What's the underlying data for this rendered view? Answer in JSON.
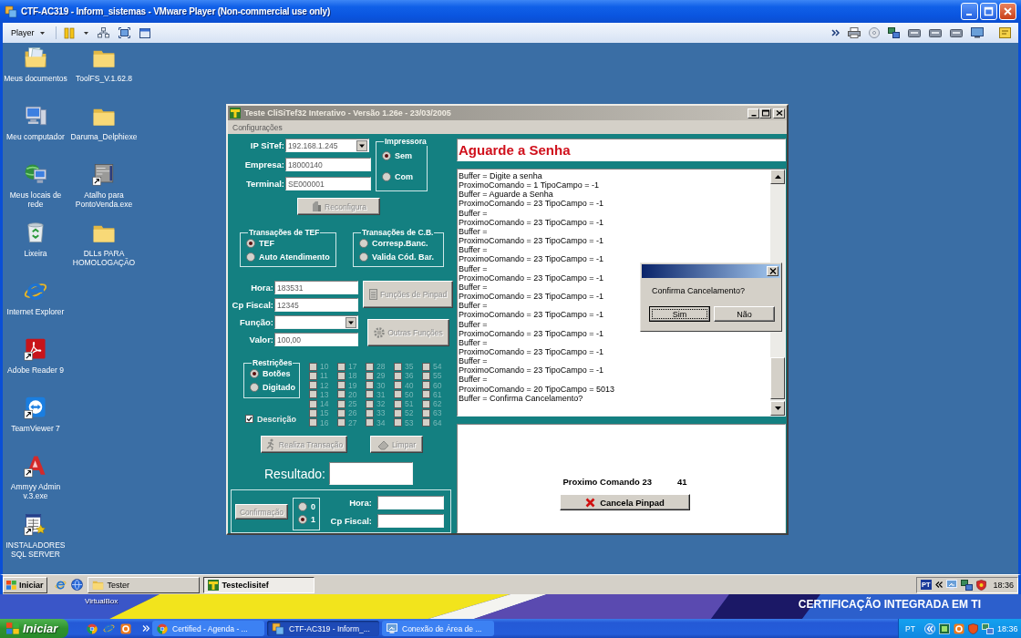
{
  "vm_window": {
    "title": "CTF-AC319 - Inform_sistemas - VMware Player (Non-commercial use only)",
    "player_menu": "Player"
  },
  "desktop_icons": [
    {
      "label": "Meus documentos",
      "kind": "documents",
      "shortcut": false
    },
    {
      "label": "Meu computador",
      "kind": "computer",
      "shortcut": false
    },
    {
      "label": "Meus locais de rede",
      "kind": "network",
      "shortcut": false
    },
    {
      "label": "Lixeira",
      "kind": "bin",
      "shortcut": false
    },
    {
      "label": "Internet Explorer",
      "kind": "browser",
      "shortcut": false
    },
    {
      "label": "Adobe Reader 9",
      "kind": "pdf",
      "shortcut": true
    },
    {
      "label": "TeamViewer 7",
      "kind": "remote",
      "shortcut": true
    },
    {
      "label": "Ammyy Admin v.3.exe",
      "kind": "admin",
      "shortcut": true
    },
    {
      "label": "INSTALADORES SQL SERVER",
      "kind": "installer",
      "shortcut": true
    },
    {
      "label": "ToolFS_V.1.62.8",
      "kind": "folder",
      "shortcut": false
    },
    {
      "label": "Daruma_Delphiexe",
      "kind": "folder",
      "shortcut": false
    },
    {
      "label": "Atalho para PontoVenda.exe",
      "kind": "program",
      "shortcut": true
    },
    {
      "label": "DLLs PARA HOMOLOGAÇÃO",
      "kind": "folder",
      "shortcut": false
    }
  ],
  "app_window": {
    "title": "Teste CliSiTef32 Interativo - Versão 1.26e - 23/03/2005",
    "menu": [
      "Configurações"
    ],
    "connection_fields": [
      {
        "label": "IP SiTef:",
        "value": "192.168.1.245",
        "kind": "combo"
      },
      {
        "label": "Empresa:",
        "value": "18000140",
        "kind": "text"
      },
      {
        "label": "Terminal:",
        "value": "SE000001",
        "kind": "text"
      }
    ],
    "printer_group": {
      "title": "Impressora",
      "options": [
        {
          "label": "Sem",
          "selected": true
        },
        {
          "label": "Com",
          "selected": false
        }
      ]
    },
    "reconfigure_button": {
      "label": "Reconfigura",
      "disabled": true
    },
    "tef_group": {
      "title": "Transações de TEF",
      "options": [
        {
          "label": "TEF",
          "selected": true
        },
        {
          "label": "Auto Atendimento",
          "selected": false
        }
      ]
    },
    "cb_group": {
      "title": "Transações de C.B.",
      "options": [
        {
          "label": "Corresp.Banc.",
          "selected": false
        },
        {
          "label": "Valida Cód. Bar.",
          "selected": false
        }
      ]
    },
    "transaction_fields": [
      {
        "label": "Hora:",
        "value": "183531",
        "kind": "text"
      },
      {
        "label": "Cp Fiscal:",
        "value": "12345",
        "kind": "text"
      },
      {
        "label": "Função:",
        "kind": "combo"
      },
      {
        "label": "Valor:",
        "value": "100,00",
        "kind": "text"
      }
    ],
    "pinpad_button": {
      "label": "Funções de Pinpad",
      "disabled": true
    },
    "other_functions_button": {
      "label": "Outras Funções",
      "disabled": true
    },
    "restrictions_group": {
      "title": "Restrições",
      "options": [
        {
          "label": "Botões",
          "selected": true
        },
        {
          "label": "Digitado",
          "selected": false
        }
      ]
    },
    "description_checkbox": {
      "label": "Descrição",
      "checked": true
    },
    "code_checkboxes": [
      {
        "label": "10",
        "checked": false,
        "disabled": true
      },
      {
        "label": "11",
        "checked": false,
        "disabled": true
      },
      {
        "label": "12",
        "checked": false,
        "disabled": true
      },
      {
        "label": "13",
        "checked": false,
        "disabled": true
      },
      {
        "label": "14",
        "checked": false,
        "disabled": true
      },
      {
        "label": "15",
        "checked": false,
        "disabled": true
      },
      {
        "label": "16",
        "checked": false,
        "disabled": true
      },
      {
        "label": "17",
        "checked": false,
        "disabled": true
      },
      {
        "label": "18",
        "checked": false,
        "disabled": true
      },
      {
        "label": "19",
        "checked": false,
        "disabled": true
      },
      {
        "label": "20",
        "checked": false,
        "disabled": true
      },
      {
        "label": "25",
        "checked": false,
        "disabled": true
      },
      {
        "label": "26",
        "checked": false,
        "disabled": true
      },
      {
        "label": "27",
        "checked": false,
        "disabled": true
      },
      {
        "label": "28",
        "checked": false,
        "disabled": true
      },
      {
        "label": "29",
        "checked": false,
        "disabled": true
      },
      {
        "label": "30",
        "checked": false,
        "disabled": true
      },
      {
        "label": "31",
        "checked": false,
        "disabled": true
      },
      {
        "label": "32",
        "checked": false,
        "disabled": true
      },
      {
        "label": "33",
        "checked": false,
        "disabled": true
      },
      {
        "label": "34",
        "checked": false,
        "disabled": true
      },
      {
        "label": "35",
        "checked": false,
        "disabled": true
      },
      {
        "label": "36",
        "checked": false,
        "disabled": true
      },
      {
        "label": "40",
        "checked": false,
        "disabled": true
      },
      {
        "label": "50",
        "checked": false,
        "disabled": true
      },
      {
        "label": "51",
        "checked": false,
        "disabled": true
      },
      {
        "label": "52",
        "checked": false,
        "disabled": true
      },
      {
        "label": "53",
        "checked": false,
        "disabled": true
      },
      {
        "label": "54",
        "checked": false,
        "disabled": true
      },
      {
        "label": "55",
        "checked": false,
        "disabled": true
      },
      {
        "label": "60",
        "checked": false,
        "disabled": true
      },
      {
        "label": "61",
        "checked": false,
        "disabled": true
      },
      {
        "label": "62",
        "checked": false,
        "disabled": true
      },
      {
        "label": "63",
        "checked": false,
        "disabled": true
      },
      {
        "label": "64",
        "checked": false,
        "disabled": true
      }
    ],
    "action_buttons": [
      {
        "label": "Realiza Transação",
        "kind": "run",
        "disabled": true
      },
      {
        "label": "Limpar",
        "kind": "clear",
        "disabled": true
      }
    ],
    "result": {
      "label": "Resultado:"
    },
    "confirmation": {
      "button": {
        "label": "Confirmação",
        "disabled": true
      },
      "options": [
        {
          "label": "0",
          "selected": false
        },
        {
          "label": "1",
          "selected": true
        }
      ],
      "fields": [
        {
          "label": "Hora:"
        },
        {
          "label": "Cp Fiscal:"
        }
      ]
    },
    "status_message": "Aguarde a Senha",
    "log_lines": [
      "Buffer = Digite a senha",
      "ProximoComando = 1 TipoCampo = -1",
      "Buffer = Aguarde a Senha",
      "ProximoComando = 23 TipoCampo = -1",
      "Buffer =",
      "ProximoComando = 23 TipoCampo = -1",
      "Buffer =",
      "ProximoComando = 23 TipoCampo = -1",
      "Buffer =",
      "ProximoComando = 23 TipoCampo = -1",
      "Buffer =",
      "ProximoComando = 23 TipoCampo = -1",
      "Buffer =",
      "ProximoComando = 23 TipoCampo = -1",
      "Buffer =",
      "ProximoComando = 23 TipoCampo = -1",
      "Buffer =",
      "ProximoComando = 23 TipoCampo = -1",
      "Buffer =",
      "ProximoComando = 23 TipoCampo = -1",
      "Buffer =",
      "ProximoComando = 23 TipoCampo = -1",
      "Buffer =",
      "ProximoComando = 20 TipoCampo = 5013",
      "Buffer = Confirma Cancelamento?"
    ],
    "next_command": {
      "label": "Proximo Comando 23",
      "value": "41"
    },
    "cancel_pinpad_button": {
      "label": "Cancela Pinpad"
    }
  },
  "confirm_dialog": {
    "message": "Confirma Cancelamento?",
    "buttons": [
      {
        "label": "Sim",
        "focused": true
      },
      {
        "label": "Não",
        "focused": false
      }
    ]
  },
  "guest_taskbar": {
    "start_label": "Iniciar",
    "tasks": [
      {
        "label": "Tester",
        "kind": "folder",
        "selected": false
      },
      {
        "label": "Testeclisitef",
        "kind": "app",
        "selected": true
      }
    ],
    "language": "PT",
    "clock": "18:36"
  },
  "host_desktop": {
    "icon_label": "VirtualBox",
    "wallpaper_text": "CERTIFICAÇÃO INTEGRADA EM TI"
  },
  "host_taskbar": {
    "start_label": "Iniciar",
    "tasks": [
      {
        "label": "Certified - Agenda - ...",
        "kind": "browser",
        "selected": false
      },
      {
        "label": "CTF-AC319 - Inform_...",
        "kind": "vm",
        "selected": true
      },
      {
        "label": "Conexão de Área de ...",
        "kind": "remote",
        "selected": false
      }
    ],
    "language": "PT",
    "clock": "18:36"
  }
}
